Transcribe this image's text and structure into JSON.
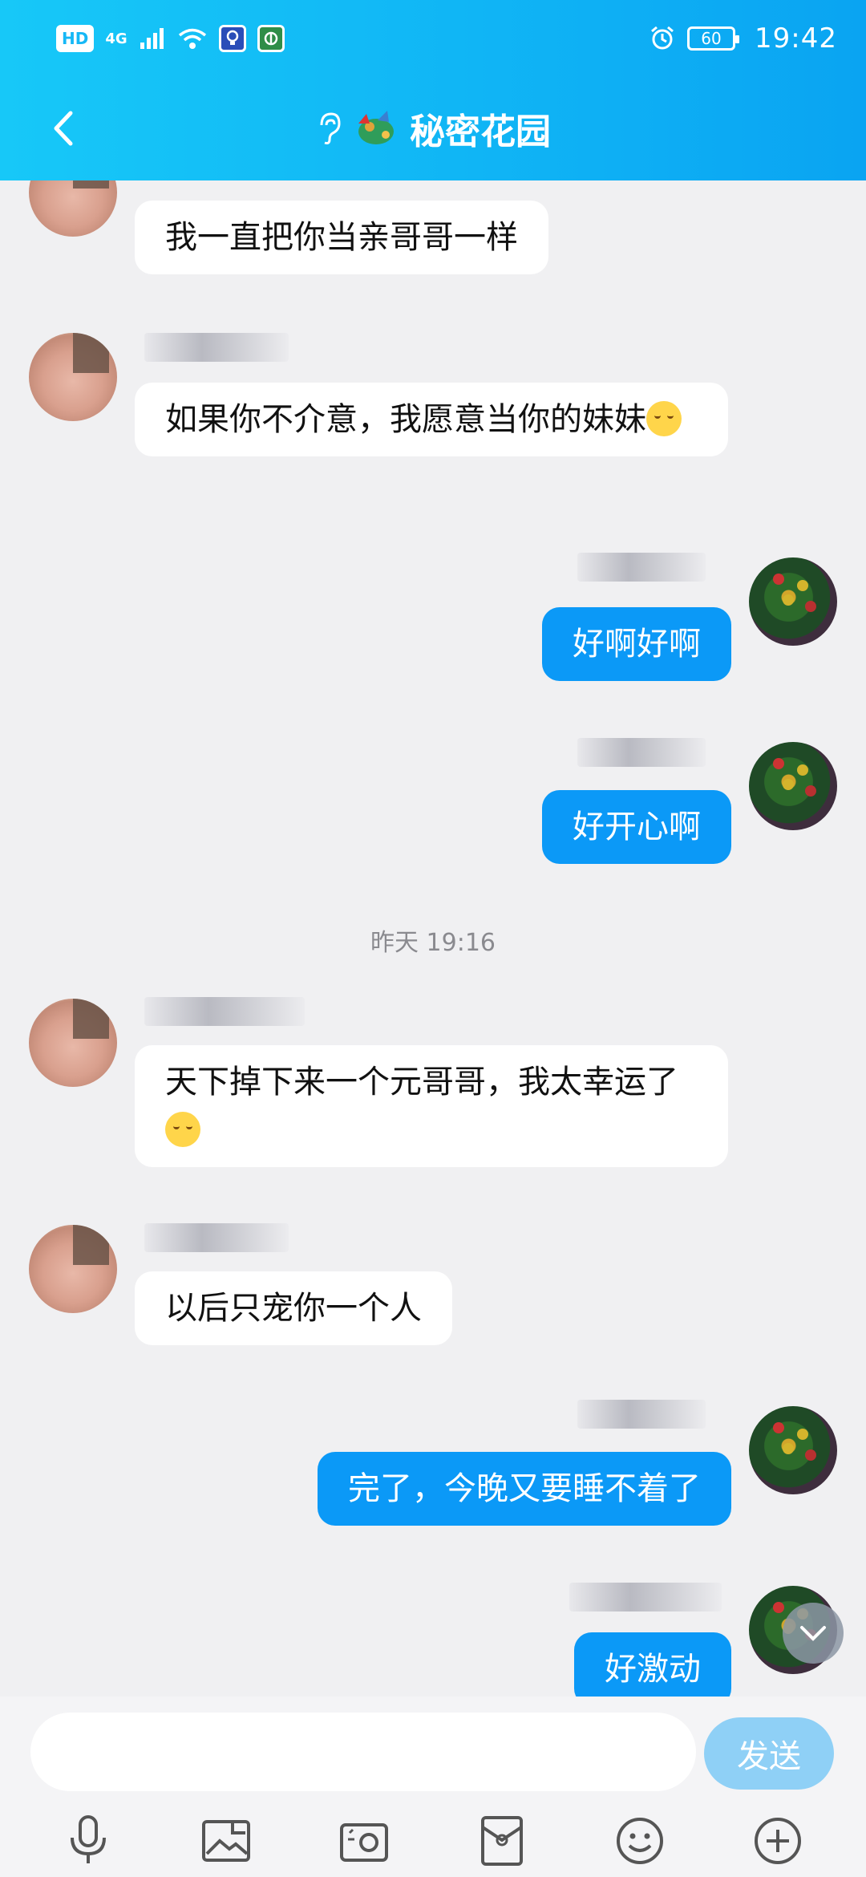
{
  "status_bar": {
    "hd": "HD",
    "network": "4G",
    "battery": "60",
    "time": "19:42"
  },
  "header": {
    "title": "秘密花园",
    "back_icon": "chevron-left-icon",
    "ear_icon": "ear-icon"
  },
  "messages": [
    {
      "side": "in",
      "text": "我一直把你当亲哥哥一样"
    },
    {
      "side": "in",
      "text": "如果你不介意，我愿意当你的妹妹"
    },
    {
      "side": "out",
      "text": "好啊好啊"
    },
    {
      "side": "out",
      "text": "好开心啊"
    },
    {
      "type": "timestamp",
      "text": "昨天 19:16"
    },
    {
      "side": "in",
      "text": "天下掉下来一个元哥哥，我太幸运了"
    },
    {
      "side": "in",
      "text": "以后只宠你一个人"
    },
    {
      "side": "out",
      "text": "完了，今晚又要睡不着了"
    },
    {
      "side": "out",
      "text": "好激动"
    }
  ],
  "input": {
    "placeholder": "",
    "send_label": "发送"
  },
  "toolbar": [
    "microphone-icon",
    "image-icon",
    "camera-icon",
    "red-packet-icon",
    "emoji-icon",
    "plus-icon"
  ],
  "colors": {
    "header_gradient_start": "#17c8f8",
    "header_gradient_end": "#0aa4f2",
    "outgoing_bubble": "#0b99f7",
    "incoming_bubble": "#ffffff",
    "send_button": "#8fd0f6"
  }
}
